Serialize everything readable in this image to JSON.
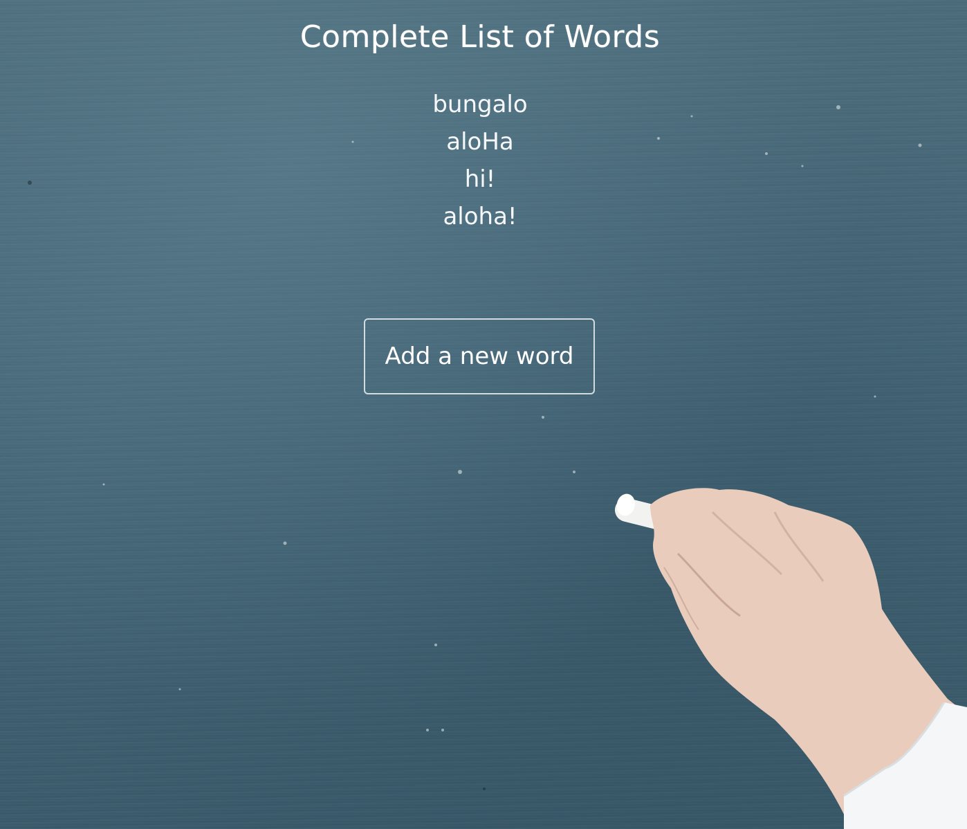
{
  "page": {
    "title": "Complete List of Words"
  },
  "words": [
    "bungalo",
    "aloHa",
    "hi!",
    "aloha!"
  ],
  "actions": {
    "add_word_label": "Add a new word"
  },
  "colors": {
    "chalkboard": "#46687a",
    "chalk_text": "#ffffff",
    "button_border": "#ebf0f2"
  },
  "decor": {
    "background": "chalkboard",
    "illustration": "hand-holding-chalk"
  }
}
